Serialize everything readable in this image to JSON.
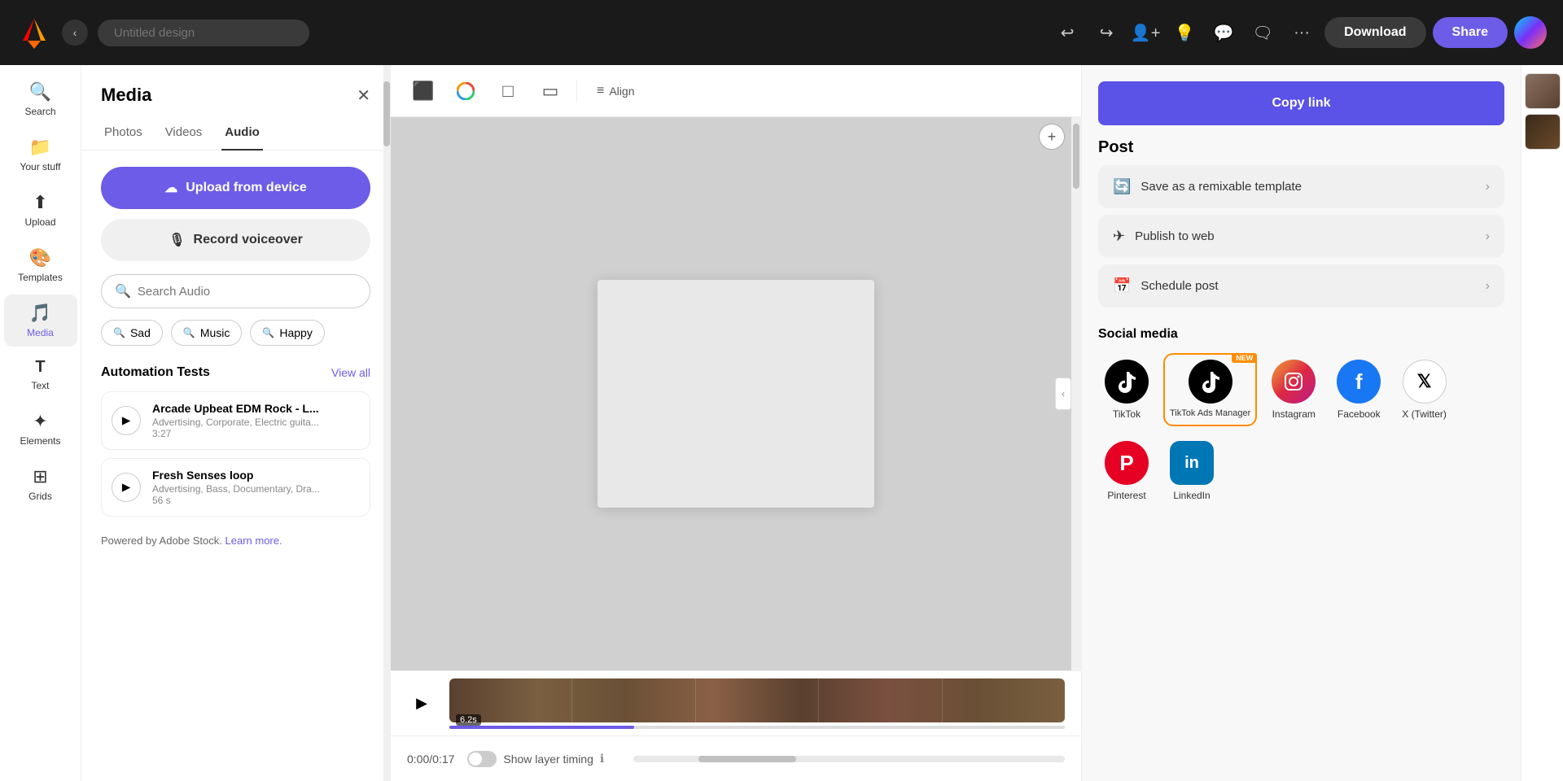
{
  "topbar": {
    "title": "",
    "title_placeholder": "Untitled design",
    "download_label": "Download",
    "share_label": "Share"
  },
  "sidebar": {
    "items": [
      {
        "id": "search",
        "label": "Search",
        "icon": "🔍"
      },
      {
        "id": "your-stuff",
        "label": "Your stuff",
        "icon": "📁"
      },
      {
        "id": "upload",
        "label": "Upload",
        "icon": "⬆"
      },
      {
        "id": "templates",
        "label": "Templates",
        "icon": "🎨"
      },
      {
        "id": "media",
        "label": "Media",
        "icon": "🎵",
        "active": true
      },
      {
        "id": "text",
        "label": "Text",
        "icon": "T"
      },
      {
        "id": "elements",
        "label": "Elements",
        "icon": "✦"
      },
      {
        "id": "grids",
        "label": "Grids",
        "icon": "⊞"
      }
    ]
  },
  "media_panel": {
    "title": "Media",
    "tabs": [
      "Photos",
      "Videos",
      "Audio"
    ],
    "active_tab": "Audio",
    "upload_btn": "Upload from device",
    "record_btn": "Record voiceover",
    "search_placeholder": "Search Audio",
    "filter_chips": [
      "Sad",
      "Music",
      "Happy"
    ],
    "section_title": "Automation Tests",
    "view_all": "View all",
    "audio_items": [
      {
        "name": "Arcade Upbeat EDM Rock - L...",
        "meta": "Advertising, Corporate, Electric guita...",
        "duration": "3:27"
      },
      {
        "name": "Fresh Senses loop",
        "meta": "Advertising, Bass, Documentary, Dra...",
        "duration": "56 s"
      }
    ],
    "adobe_stock_text": "Powered by Adobe Stock.",
    "learn_more": "Learn more."
  },
  "canvas": {
    "toolbar_tools": [
      "⬛",
      "⬜",
      "□",
      "▭"
    ],
    "align_label": "Align",
    "timestamp": "0:00/0:17",
    "show_layer_timing": "Show layer timing",
    "timeline_duration": "6.2s",
    "timeline_progress_pct": 30
  },
  "right_panel": {
    "copy_link_label": "Copy link",
    "post_section_title": "Post",
    "post_options": [
      {
        "icon": "🔄",
        "label": "Save as a remixable template"
      },
      {
        "icon": "✈",
        "label": "Publish to web"
      },
      {
        "icon": "📅",
        "label": "Schedule post"
      }
    ],
    "social_section_title": "Social media",
    "social_items": [
      {
        "id": "tiktok",
        "label": "TikTok",
        "bg": "#000",
        "color": "#fff",
        "icon": "TT"
      },
      {
        "id": "tiktok-ads",
        "label": "TikTok Ads Manager",
        "bg": "#000",
        "color": "#fff",
        "icon": "TT",
        "badge": "NEW",
        "highlighted": true
      },
      {
        "id": "instagram",
        "label": "Instagram",
        "bg": "gradient-instagram",
        "color": "#fff",
        "icon": "📷"
      },
      {
        "id": "facebook",
        "label": "Facebook",
        "bg": "#1877f2",
        "color": "#fff",
        "icon": "f"
      },
      {
        "id": "twitter",
        "label": "X (Twitter)",
        "bg": "#fff",
        "color": "#000",
        "icon": "✕"
      },
      {
        "id": "pinterest",
        "label": "Pinterest",
        "bg": "#e60023",
        "color": "#fff",
        "icon": "P"
      },
      {
        "id": "linkedin",
        "label": "LinkedIn",
        "bg": "#0077b5",
        "color": "#fff",
        "icon": "in"
      }
    ]
  }
}
